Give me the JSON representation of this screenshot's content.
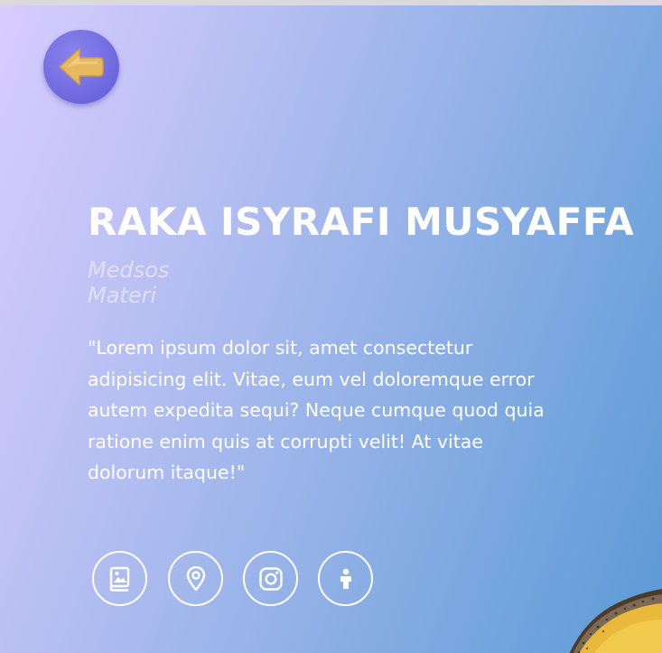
{
  "profile": {
    "name": "RAKA ISYRAFI MUSYAFFA",
    "tags": [
      "Medsos",
      "Materi"
    ],
    "quote": "\"Lorem ipsum dolor sit, amet consectetur adipisicing elit. Vitae, eum vel doloremque error autem expedita sequi? Neque cumque quod quia ratione enim quis at corrupti velit! At vitae dolorum itaque!\""
  },
  "icons": {
    "back": "arrow-left-icon",
    "social": [
      "gallery-book-icon",
      "location-pin-icon",
      "instagram-icon",
      "person-icon"
    ]
  },
  "colors": {
    "gradient_start": "#d8ccff",
    "gradient_end": "#5b9ad6",
    "back_button": "#6d67de",
    "arrow": "#e7b85f",
    "text": "#ffffff"
  }
}
